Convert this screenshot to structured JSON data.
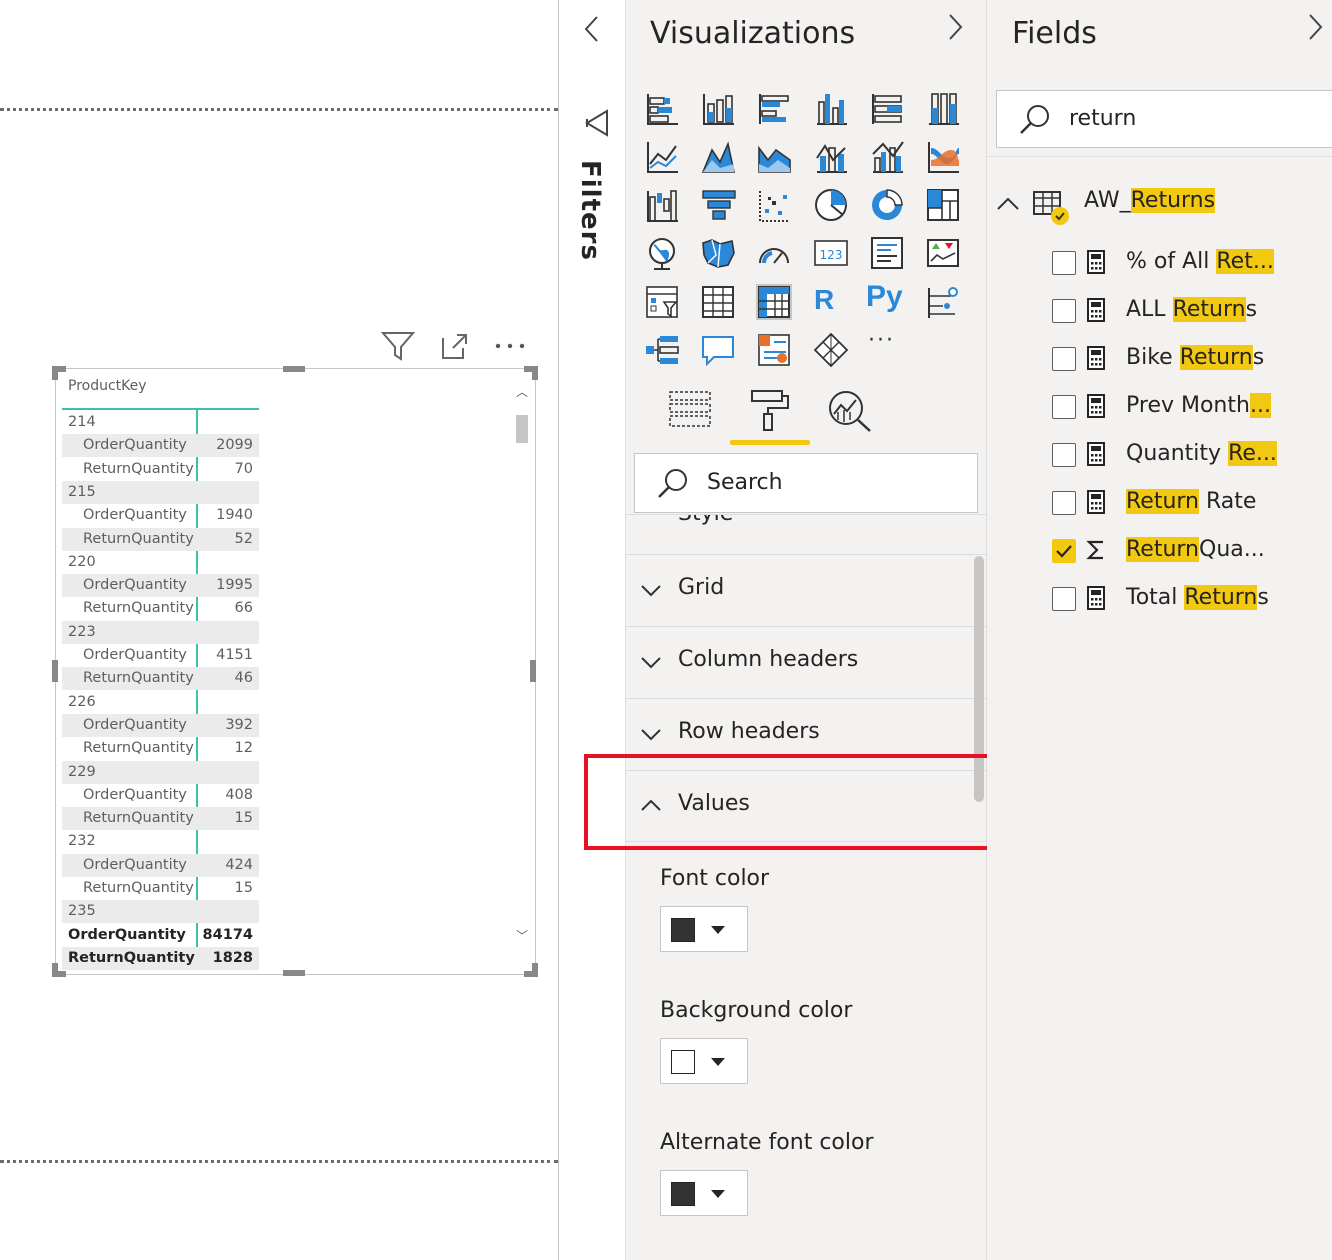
{
  "matrix": {
    "header": "ProductKey",
    "rows": [
      {
        "type": "group",
        "label": "214",
        "value": ""
      },
      {
        "type": "item",
        "label": "OrderQuantity",
        "value": "2099"
      },
      {
        "type": "item",
        "label": "ReturnQuantity",
        "value": "70"
      },
      {
        "type": "group",
        "label": "215",
        "value": ""
      },
      {
        "type": "item",
        "label": "OrderQuantity",
        "value": "1940"
      },
      {
        "type": "item",
        "label": "ReturnQuantity",
        "value": "52"
      },
      {
        "type": "group",
        "label": "220",
        "value": ""
      },
      {
        "type": "item",
        "label": "OrderQuantity",
        "value": "1995"
      },
      {
        "type": "item",
        "label": "ReturnQuantity",
        "value": "66"
      },
      {
        "type": "group",
        "label": "223",
        "value": ""
      },
      {
        "type": "item",
        "label": "OrderQuantity",
        "value": "4151"
      },
      {
        "type": "item",
        "label": "ReturnQuantity",
        "value": "46"
      },
      {
        "type": "group",
        "label": "226",
        "value": ""
      },
      {
        "type": "item",
        "label": "OrderQuantity",
        "value": "392"
      },
      {
        "type": "item",
        "label": "ReturnQuantity",
        "value": "12"
      },
      {
        "type": "group",
        "label": "229",
        "value": ""
      },
      {
        "type": "item",
        "label": "OrderQuantity",
        "value": "408"
      },
      {
        "type": "item",
        "label": "ReturnQuantity",
        "value": "15"
      },
      {
        "type": "group",
        "label": "232",
        "value": ""
      },
      {
        "type": "item",
        "label": "OrderQuantity",
        "value": "424"
      },
      {
        "type": "item",
        "label": "ReturnQuantity",
        "value": "15"
      },
      {
        "type": "group",
        "label": "235",
        "value": ""
      },
      {
        "type": "total",
        "label": "OrderQuantity",
        "value": "84174"
      },
      {
        "type": "total",
        "label": "ReturnQuantity",
        "value": "1828"
      }
    ]
  },
  "filters": {
    "title": "Filters"
  },
  "visualizations": {
    "title": "Visualizations",
    "r_label": "R",
    "py_label": "Py",
    "more_label": "···",
    "search_placeholder": "Search",
    "sections": {
      "style_partial": "Style",
      "grid": "Grid",
      "column_headers": "Column headers",
      "row_headers": "Row headers",
      "values": "Values"
    },
    "props": {
      "font_color": "Font color",
      "background_color": "Background color",
      "alt_font_color": "Alternate font color"
    },
    "colors": {
      "font": "#333333",
      "background": "#ffffff",
      "alt_font": "#333333"
    }
  },
  "fields": {
    "title": "Fields",
    "search_value": "return",
    "table": {
      "prefix": "AW_",
      "highlight": "Returns"
    },
    "items": [
      {
        "pre": "% of All ",
        "hl": "Ret...",
        "post": "",
        "checked": false,
        "icon": "calculator-icon"
      },
      {
        "pre": "ALL ",
        "hl": "Return",
        "post": "s",
        "checked": false,
        "icon": "calculator-icon"
      },
      {
        "pre": "Bike ",
        "hl": "Return",
        "post": "s",
        "checked": false,
        "icon": "calculator-icon"
      },
      {
        "pre": "Prev Month",
        "hl": "...",
        "post": "",
        "checked": false,
        "icon": "calculator-icon"
      },
      {
        "pre": "Quantity ",
        "hl": "Re...",
        "post": "",
        "checked": false,
        "icon": "calculator-icon"
      },
      {
        "pre": "",
        "hl": "Return",
        "post": " Rate",
        "checked": false,
        "icon": "calculator-icon"
      },
      {
        "pre": "",
        "hl": "Return",
        "post": "Qua...",
        "checked": true,
        "icon": "sigma-icon"
      },
      {
        "pre": "Total ",
        "hl": "Return",
        "post": "s",
        "checked": false,
        "icon": "calculator-icon"
      }
    ]
  },
  "theme": {
    "accent": "#f2c811",
    "matrix_line": "#3fbfa8",
    "callout": "#e81123",
    "icon_blue": "#2b88d8"
  }
}
